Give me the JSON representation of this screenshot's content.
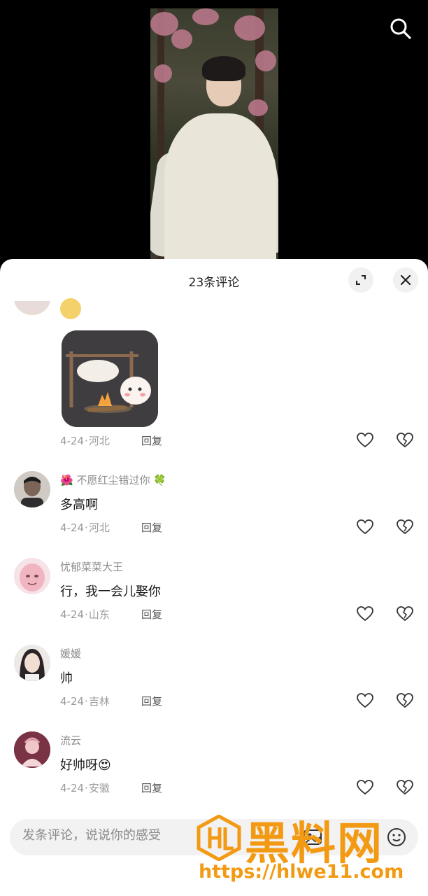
{
  "header": {
    "title": "23条评论"
  },
  "icons": {
    "search": "search-icon",
    "expand": "expand-icon",
    "close": "close-icon",
    "like": "heart-icon",
    "dislike": "broken-heart-icon"
  },
  "comments": [
    {
      "name": "",
      "text": "",
      "date": "4-24",
      "region": "河北",
      "reply": "回复",
      "has_sticker": true
    },
    {
      "name": "🌺 不愿红尘错过你 🍀",
      "text": "多高啊",
      "date": "4-24",
      "region": "河北",
      "reply": "回复"
    },
    {
      "name": "忧郁菜菜大王",
      "text": "行，我一会儿娶你",
      "date": "4-24",
      "region": "山东",
      "reply": "回复"
    },
    {
      "name": "媛媛",
      "text": "帅",
      "date": "4-24",
      "region": "吉林",
      "reply": "回复"
    },
    {
      "name": "流云",
      "text": "好帅呀😍",
      "date": "4-24",
      "region": "安徽",
      "reply": "回复"
    }
  ],
  "input": {
    "placeholder": "发条评论，说说你的感受"
  },
  "watermark": {
    "brand": "黑料网",
    "url": "https://hlwe11.com"
  },
  "colors": {
    "watermark": "#f39a14",
    "sheet_bg": "#ffffff",
    "top_bg": "#000000"
  }
}
